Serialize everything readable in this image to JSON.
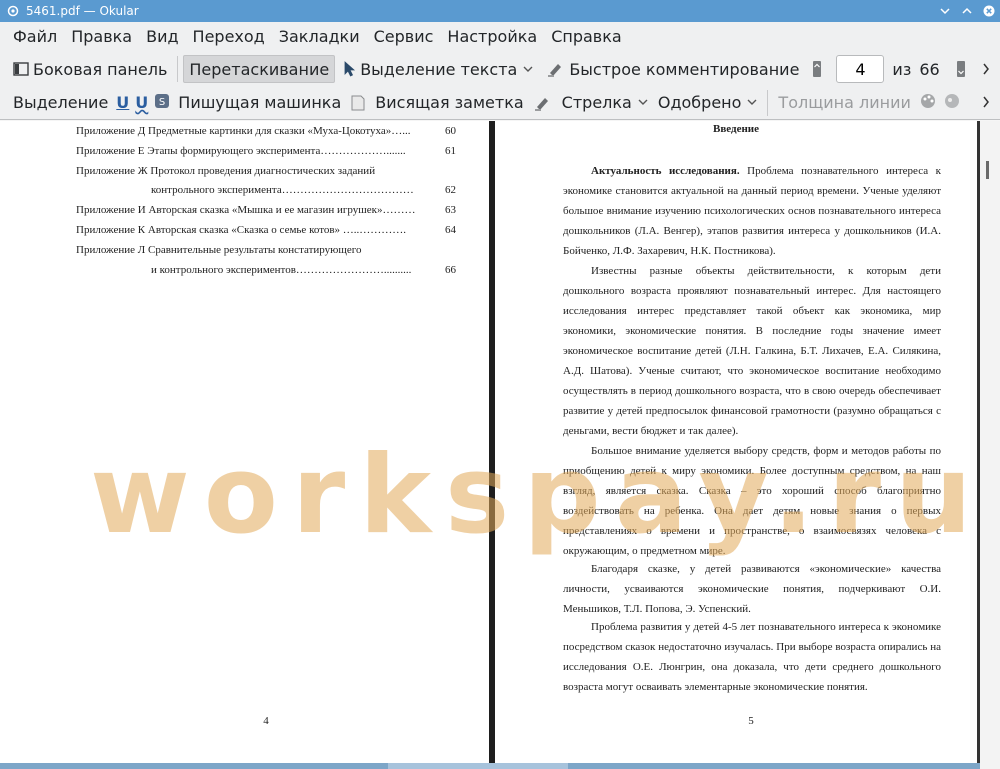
{
  "window": {
    "title": "5461.pdf — Okular"
  },
  "menubar": [
    "Файл",
    "Правка",
    "Вид",
    "Переход",
    "Закладки",
    "Сервис",
    "Настройка",
    "Справка"
  ],
  "toolbar1": {
    "sidebar": "Боковая панель",
    "browse": "Перетаскивание",
    "text_select": "Выделение текста",
    "quick_annot": "Быстрое комментирование",
    "page_current": "4",
    "page_of": "из",
    "page_total": "66"
  },
  "toolbar2": {
    "selection": "Выделение",
    "typewriter": "Пишущая машинка",
    "note": "Висящая заметка",
    "arrow": "Стрелка",
    "stamp": "Одобрено",
    "line_width": "Толщина линии"
  },
  "left_page": {
    "toc": [
      {
        "text": "Приложение Д Предметные картинки для сказки «Муха-Цокотуха»…...",
        "num": "60"
      },
      {
        "text": "Приложение Е Этапы формирующего эксперимента……………….......",
        "num": "61"
      },
      {
        "text": "Приложение Ж Протокол проведения диагностических заданий",
        "num": ""
      },
      {
        "text": "контрольного эксперимента………………………………",
        "num": "62",
        "indent": true
      },
      {
        "text": "Приложение И Авторская сказка «Мышка и ее магазин игрушек»………",
        "num": "63"
      },
      {
        "text": "Приложение К Авторская сказка «Сказка о семье котов» …..………….",
        "num": "64"
      },
      {
        "text": "Приложение Л Сравнительные результаты констатирующего",
        "num": ""
      },
      {
        "text": "и контрольного экспериментов……………………..........",
        "num": "66",
        "indent": true
      }
    ],
    "page_number": "4"
  },
  "right_page": {
    "heading": "Введение",
    "paragraphs": [
      {
        "lead": "Актуальность исследования.",
        "text": " Проблема познавательного интереса к экономике становится актуальной на данный период времени. Ученые уделяют большое внимание изучению психологических основ познавательного интереса дошкольников (Л.А. Венгер), этапов развития интереса у дошкольников (И.А. Бойченко, Л.Ф. Захаревич, Н.К. Постникова)."
      },
      {
        "lead": "",
        "text": "Известны разные объекты действительности, к которым дети дошкольного возраста проявляют познавательный интерес. Для настоящего исследования интерес представляет такой объект как экономика, мир экономики, экономические понятия. В последние годы значение имеет экономическое воспитание детей (Л.Н. Галкина, Б.Т. Лихачев, Е.А. Силякина, А.Д. Шатова). Ученые считают, что экономическое воспитание необходимо осуществлять в период дошкольного возраста, что в свою очередь обеспечивает развитие у детей предпосылок финансовой грамотности (разумно обращаться с деньгами, вести бюджет и так далее)."
      },
      {
        "lead": "",
        "text": "Большое внимание уделяется выбору средств, форм и методов работы по приобщению детей к миру экономики. Более доступным средством, на наш взгляд, является сказка. Сказка – это хороший способ благоприятно воздействовать на ребенка. Она дает детям новые знания о первых представлениях о времени и пространстве, о взаимосвязях человека с окружающим, о предметном мире."
      },
      {
        "lead": "",
        "text": "Благодаря сказке, у детей развиваются «экономические» качества личности, усваиваются экономические понятия, подчеркивают О.И. Меньшиков, Т.Л. Попова, Э. Успенский."
      },
      {
        "lead": "",
        "text": "Проблема развития у детей 4-5 лет познавательного интереса к экономике посредством сказок недостаточно изучалась. При выборе возраста опирались на исследования О.Е. Люнгрин, она доказала, что дети среднего дошкольного возраста могут осваивать элементарные экономические понятия."
      }
    ],
    "page_number": "5"
  },
  "watermark": "workspay.ru"
}
